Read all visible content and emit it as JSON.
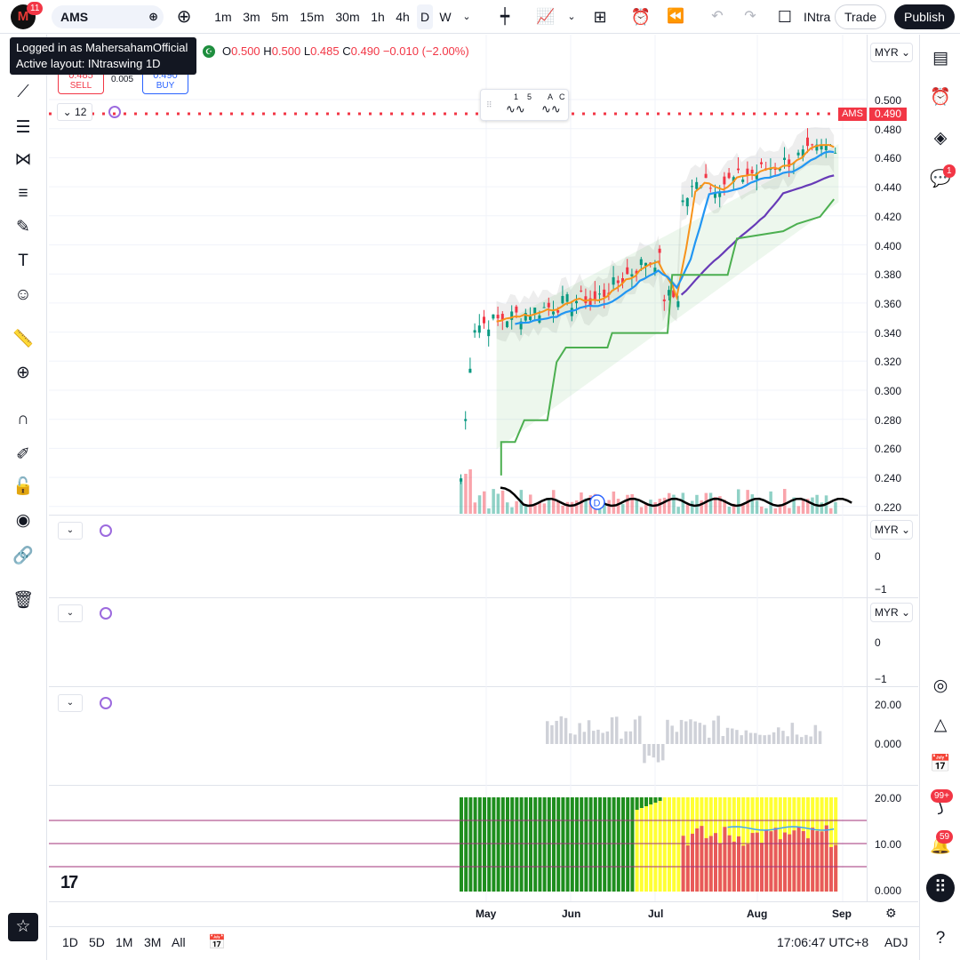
{
  "topbar": {
    "logo_text": "M",
    "notif_badge": "11",
    "symbol": "AMS",
    "intervals": [
      "1m",
      "3m",
      "5m",
      "15m",
      "30m",
      "1h",
      "4h",
      "D",
      "W"
    ],
    "active_interval": "D",
    "layout_name": "INtra",
    "trade_label": "Trade",
    "publish_label": "Publish"
  },
  "tooltip": {
    "line1": "Logged in as MahersahamOfficial",
    "line2": "Active layout: INtraswing 1D"
  },
  "legend": {
    "o_label": "O",
    "o": "0.500",
    "h_label": "H",
    "h": "0.500",
    "l_label": "L",
    "l": "0.485",
    "c_label": "C",
    "c": "0.490",
    "change": "−0.010 (−2.00%)"
  },
  "order": {
    "sell_price": "0.485",
    "sell_label": "SELL",
    "spread": "0.005",
    "buy_price": "0.490",
    "buy_label": "BUY"
  },
  "interval_value": "12",
  "currency": "MYR",
  "last_price_symbol": "AMS",
  "last_price": "0.490",
  "pattern_labels": {
    "a": "1",
    "b": "5",
    "c": "A",
    "d": "C"
  },
  "price_ticks": [
    "0.500",
    "0.480",
    "0.460",
    "0.440",
    "0.420",
    "0.400",
    "0.380",
    "0.360",
    "0.340",
    "0.320",
    "0.300",
    "0.280",
    "0.260",
    "0.240",
    "0.220"
  ],
  "pane2_ticks": [
    "0",
    "−1"
  ],
  "pane3_ticks": [
    "0",
    "−1"
  ],
  "pane4_ticks": [
    "20.00",
    "0.000"
  ],
  "pane5_ticks": [
    "20.00",
    "10.00",
    "0.000"
  ],
  "dividend_marker": "D",
  "months": [
    "May",
    "Jun",
    "Jul",
    "Aug",
    "Sep"
  ],
  "bottombar": {
    "ranges": [
      "1D",
      "5D",
      "1M",
      "3M",
      "All"
    ],
    "clock": "17:06:47 UTC+8",
    "adj": "ADJ"
  },
  "right_badges": {
    "chat": "1",
    "streams": "99+",
    "alerts": "59"
  },
  "colors": {
    "up": "#089981",
    "down": "#f23645",
    "accent": "#2962ff",
    "ema_orange": "#f7931a",
    "ema_blue": "#2196f3",
    "ema_purple": "#673ab7",
    "stop_green": "#4caf50"
  }
}
